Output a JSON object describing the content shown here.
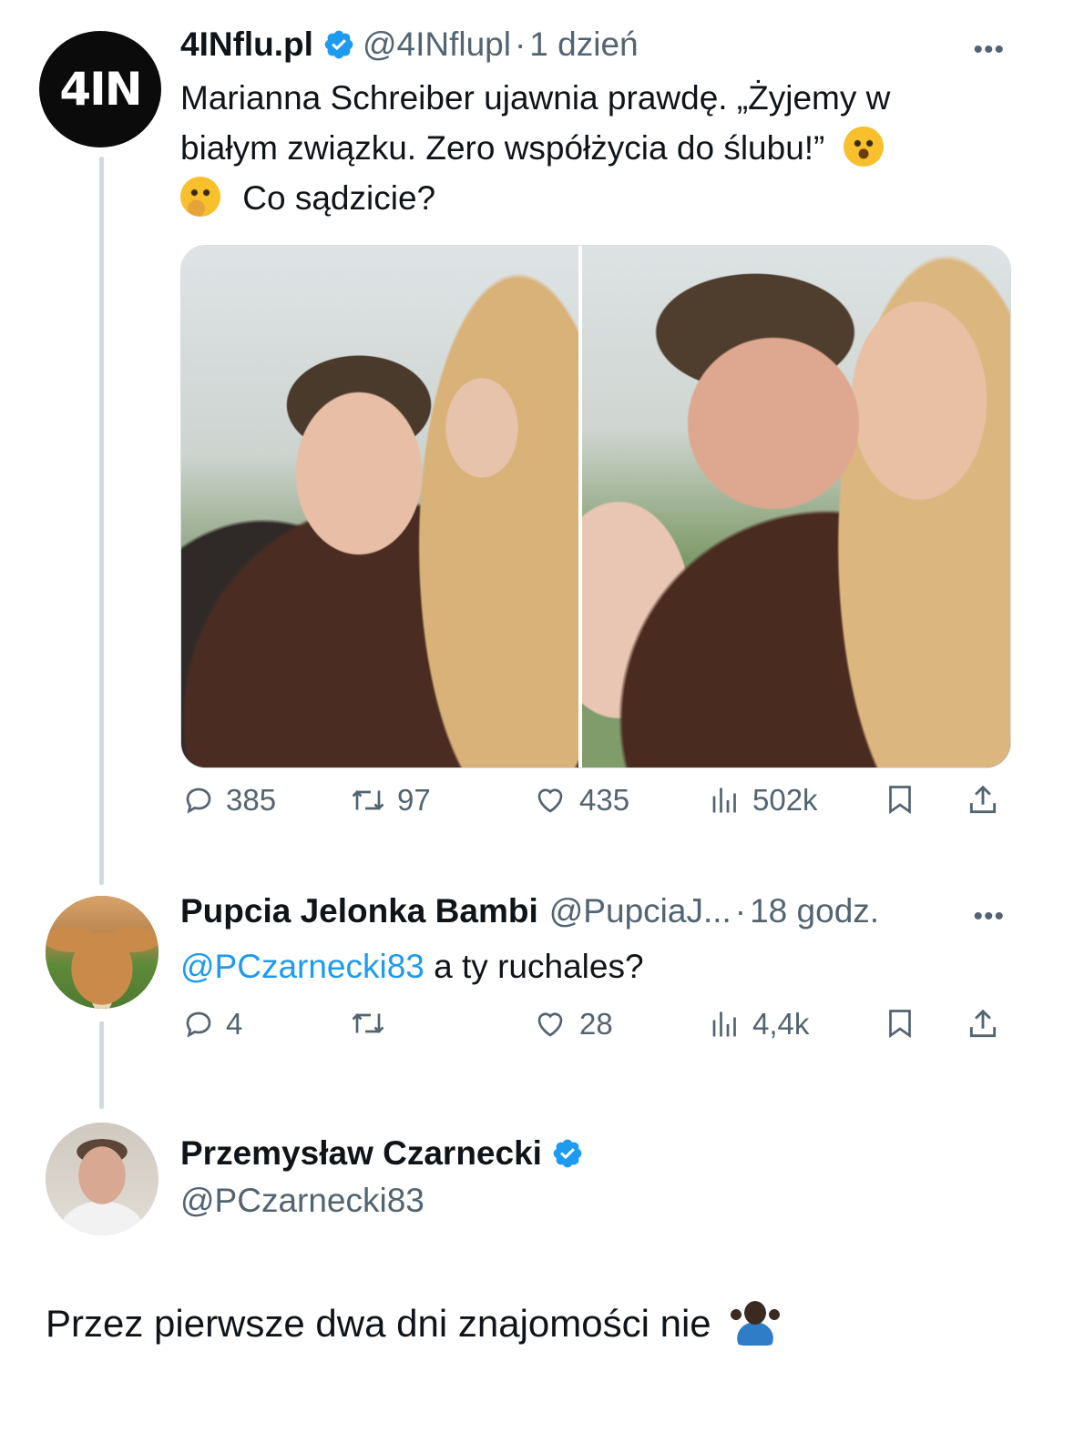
{
  "tweet": {
    "avatar_text": "4IN",
    "name": "4INflu.pl",
    "handle": "@4INflupl",
    "separator": "·",
    "time": "1 dzień",
    "more": "•••",
    "text_line1": "Marianna Schreiber ujawnia prawdę. „Żyjemy w",
    "text_line2": "białym związku. Zero współżycia do ślubu!”",
    "text_line3": "Co sądzicie?",
    "stats": {
      "replies": "385",
      "retweets": "97",
      "likes": "435",
      "views": "502k"
    }
  },
  "reply": {
    "name": "Pupcia Jelonka Bambi",
    "handle": "@PupciaJ...",
    "separator": "·",
    "time": "18 godz.",
    "more": "•••",
    "mention": "@PCzarnecki83",
    "text": " a ty ruchales?",
    "stats": {
      "replies": "4",
      "retweets": "",
      "likes": "28",
      "views": "4,4k"
    }
  },
  "focused": {
    "name": "Przemysław Czarnecki",
    "handle": "@PCzarnecki83",
    "text": "Przez pierwsze dwa dni znajomości nie"
  },
  "icons": {
    "verified": "verified-badge-icon",
    "reply": "reply-bubble-icon",
    "retweet": "retweet-icon",
    "like": "heart-icon",
    "views": "views-bars-icon",
    "bookmark": "bookmark-icon",
    "share": "share-icon"
  },
  "colors": {
    "accent": "#1d9bf0",
    "muted": "#536471",
    "text": "#0f1419",
    "line": "#cfd9de"
  }
}
